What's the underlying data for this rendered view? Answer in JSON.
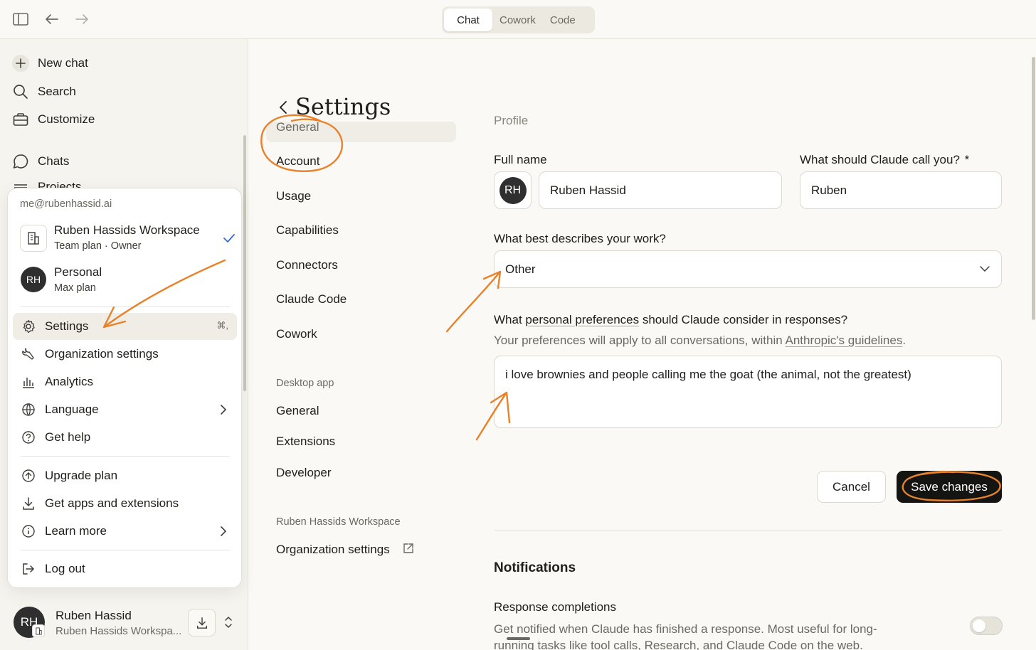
{
  "topbar": {
    "tabs": [
      {
        "label": "Chat",
        "active": true
      },
      {
        "label": "Cowork",
        "active": false
      },
      {
        "label": "Code",
        "active": false
      }
    ]
  },
  "sidebar": {
    "new_chat": "New chat",
    "search": "Search",
    "customize": "Customize",
    "chats": "Chats",
    "projects_partial": "Projects"
  },
  "account_menu": {
    "email": "me@rubenhassid.ai",
    "workspaces": [
      {
        "name": "Ruben Hassids Workspace",
        "plan": "Team plan · Owner",
        "selected": true
      },
      {
        "name": "Personal",
        "plan": "Max plan",
        "initials": "RH",
        "selected": false
      }
    ],
    "items": [
      {
        "label": "Settings",
        "shortcut": "⌘,",
        "icon": "gear-icon"
      },
      {
        "label": "Organization settings",
        "icon": "wrench-icon"
      },
      {
        "label": "Analytics",
        "icon": "bar-chart-icon"
      },
      {
        "label": "Language",
        "icon": "globe-icon"
      },
      {
        "label": "Get help",
        "icon": "help-icon"
      },
      {
        "label": "Upgrade plan",
        "icon": "upgrade-icon"
      },
      {
        "label": "Get apps and extensions",
        "icon": "download-icon"
      },
      {
        "label": "Learn more",
        "icon": "info-icon"
      },
      {
        "label": "Log out",
        "icon": "logout-icon"
      }
    ]
  },
  "user": {
    "initials": "RH",
    "name": "Ruben Hassid",
    "workspace": "Ruben Hassids Workspa..."
  },
  "settings_nav": {
    "title": "Settings",
    "items": [
      "General",
      "Account",
      "Usage",
      "Capabilities",
      "Connectors",
      "Claude Code",
      "Cowork"
    ],
    "desktop_heading": "Desktop app",
    "desktop_items": [
      "General",
      "Extensions",
      "Developer"
    ],
    "workspace_heading": "Ruben Hassids Workspace",
    "org_settings": "Organization settings"
  },
  "profile": {
    "section_partial": "Profile",
    "full_name_label": "Full name",
    "avatar_initials": "RH",
    "full_name_value": "Ruben Hassid",
    "call_you_label": "What should Claude call you?",
    "required_mark": "*",
    "call_you_value": "Ruben",
    "work_label": "What best describes your work?",
    "work_value": "Other",
    "prefs_label_pre": "What ",
    "prefs_label_link": "personal preferences",
    "prefs_label_post": " should Claude consider in responses?",
    "prefs_sub_pre": "Your preferences will apply to all conversations, within ",
    "prefs_sub_link": "Anthropic's guidelines",
    "prefs_sub_post": ".",
    "prefs_value": "i love brownies and people calling me the goat (the animal, not the greatest)",
    "cancel": "Cancel",
    "save": "Save changes"
  },
  "notifications": {
    "title": "Notifications",
    "response_title": "Response completions",
    "response_desc_1": "Get notified when Claude has finished a response. Most useful for long-",
    "response_desc_2": "running tasks like tool calls, Research, and Claude Code on the web.",
    "enabled": false
  },
  "colors": {
    "annotation": "#e8822a",
    "accent_check": "#2f6fd6",
    "save_bg": "#141413"
  }
}
